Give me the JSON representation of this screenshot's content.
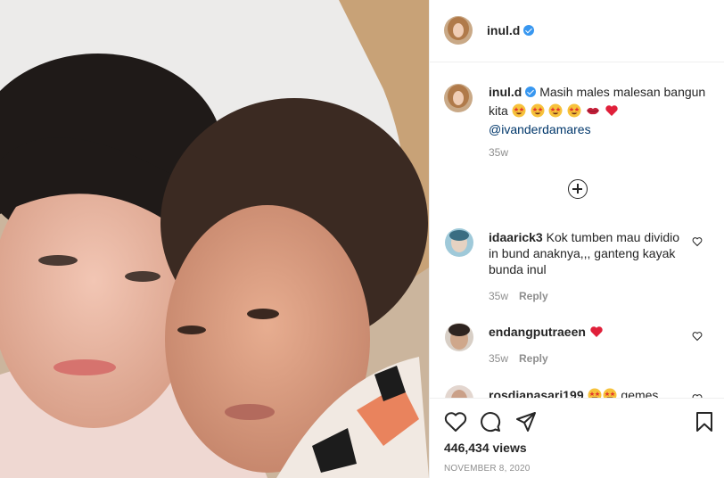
{
  "post": {
    "username": "inul.d",
    "caption_text": "Masih males malesan bangun kita",
    "caption_emojis": [
      "star-struck-face-emoji",
      "star-struck-face-emoji",
      "star-struck-face-emoji",
      "star-struck-face-emoji",
      "kiss-lips-emoji",
      "red-heart-emoji"
    ],
    "mention": "@ivanderdamares",
    "caption_age": "35w"
  },
  "comments": [
    {
      "username": "idaarick3",
      "text": "Kok tumben mau dividio in bund anaknya,,, ganteng kayak bunda inul",
      "age": "35w",
      "reply_label": "Reply",
      "emojis": []
    },
    {
      "username": "endangputraeen",
      "text": "",
      "age": "35w",
      "reply_label": "Reply",
      "emojis": [
        "red-heart-emoji"
      ]
    },
    {
      "username": "rosdianasari199",
      "text": "gemes",
      "age": "",
      "reply_label": "",
      "emojis": [
        "star-struck-face-emoji",
        "star-struck-face-emoji"
      ]
    }
  ],
  "footer": {
    "views": "446,434 views",
    "date": "NOVEMBER 8, 2020"
  },
  "colors": {
    "verified": "#3897f0",
    "mention": "#00376b",
    "meta": "#8e8e8e",
    "heart": "#ed4956"
  },
  "icons": [
    "verified-badge-icon",
    "load-more-plus-icon",
    "like-heart-icon",
    "comment-bubble-icon",
    "share-paper-plane-icon",
    "save-bookmark-icon"
  ]
}
